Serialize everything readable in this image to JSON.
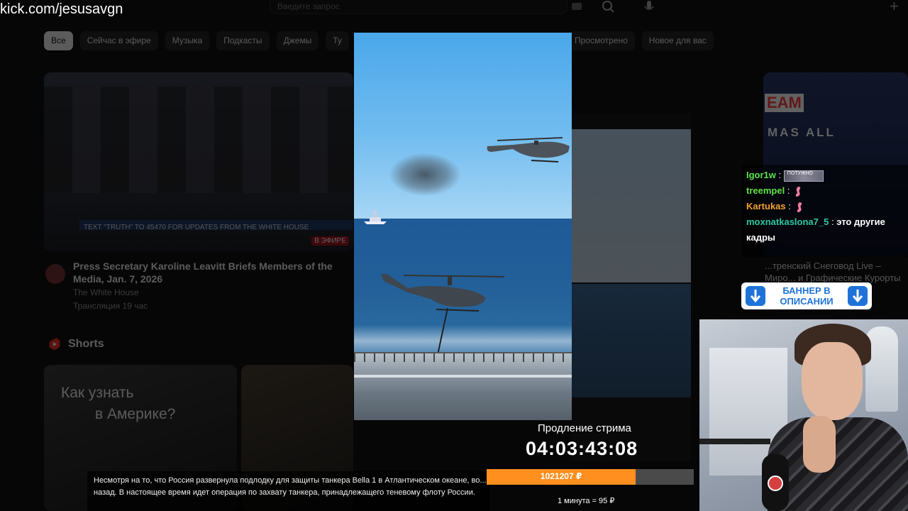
{
  "overlay": {
    "url": "kick.com/jesusavgn",
    "timer_label": "Продление стрима",
    "timer": "04:03:43:08",
    "progress_amount": "1021207 ₽",
    "progress_fraction": 0.72,
    "rate": "1 минута = 95 ₽",
    "accent": "#ff8f1f"
  },
  "chat": {
    "messages": [
      {
        "user": "Igor1w",
        "sep": ":",
        "text": "",
        "emote": "potuzhno-emote",
        "emote_text": "ПОТУЖНО",
        "color": "#5ee44e"
      },
      {
        "user": "treempel",
        "sep": ":",
        "text": "",
        "emote": "flamingo-emote",
        "color": "#62e049"
      },
      {
        "user": "Kartukas",
        "sep": ":",
        "text": "",
        "emote": "flamingo-emote",
        "color": "#f3a133"
      },
      {
        "user": "moxnatkaslona7_5",
        "sep": ":",
        "text": "это другие кадры",
        "color": "#2dc7a4"
      }
    ]
  },
  "banner": {
    "text": "БАННЕР В ОПИСАНИИ",
    "color": "#1f73d8"
  },
  "news": {
    "text": "Несмотря на то, что Россия развернула подлодку для защиты танкера Bella 1 в Атлантическом океане, во... назад. В настоящее время идет операция по захвату танкера, принадлежащего теневому флоту России."
  },
  "youtube": {
    "search_placeholder": "Введите запрос",
    "chips": [
      "Все",
      "Сейчас в эфире",
      "Музыка",
      "Подкасты",
      "Джемы",
      "Ту"
    ],
    "chips_right": [
      "Просмотрено",
      "Новое для вас"
    ],
    "video": {
      "lower_third": "TEXT \"TRUTH\" TO 45470 FOR UPDATES FROM THE WHITE HOUSE",
      "live": "В ЭФИРЕ",
      "title": "Press Secretary Karoline Leavitt Briefs Members of the Media, Jan. 7, 2026",
      "channel": "The White House",
      "views": "Трансляция 19 час"
    },
    "shorts_title": "Shorts",
    "short1_line1": "Как узнать",
    "short1_highlight": "",
    "short1_line2": "в Америке?",
    "right_promo1": "EAM",
    "right_promo2": "MAS ALL",
    "right_card_title": "...тренский Снеговод Live – Миро... и Графические Курорты"
  }
}
